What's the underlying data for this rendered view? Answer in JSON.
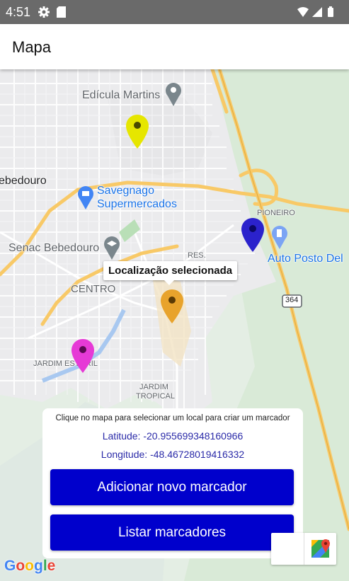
{
  "status_bar": {
    "time": "4:51"
  },
  "app_bar": {
    "title": "Mapa"
  },
  "map": {
    "labels": {
      "edicula": "Edícula Martins",
      "bebedouro": "ebedouro",
      "savegnago_1": "Savegnago",
      "savegnago_2": "Supermercados",
      "pioneiro": "PIONEIRO",
      "senac": "Senac Bebedouro",
      "res": "RES.",
      "centro": "CENTRO",
      "auto_posto": "Auto Posto Del",
      "route_364": "364",
      "jardim_estoril": "JARDIM ESTORIL",
      "jardim_tropical_1": "JARDIM",
      "jardim_tropical_2": "TROPICAL"
    },
    "tooltip": "Localização selecionada",
    "markers": [
      {
        "name": "yellow",
        "color": "#e6e600"
      },
      {
        "name": "navy",
        "color": "#2b22cc"
      },
      {
        "name": "orange",
        "color": "#e8a32c"
      },
      {
        "name": "magenta",
        "color": "#e63ad6"
      }
    ]
  },
  "panel": {
    "hint": "Clique no mapa para selecionar um local para criar um marcador",
    "latitude": "Latitude: -20.955699348160966",
    "longitude": "Longitude: -48.46728019416332",
    "add_button": "Adicionar novo marcador",
    "list_button": "Listar marcadores"
  },
  "attribution": "Google",
  "colors": {
    "button_bg": "#0000cc",
    "coordinate_text": "#2a2aa8",
    "status_bar": "#6a6a6a",
    "road_major": "#f8c967"
  }
}
